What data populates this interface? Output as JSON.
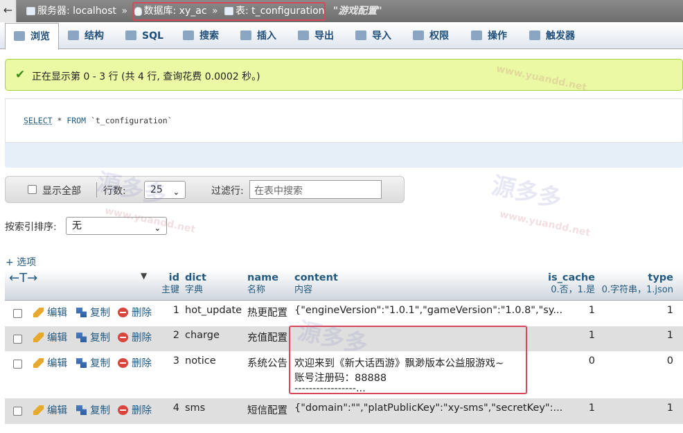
{
  "topbar": {
    "back_icon": "←",
    "server_label": "服务器: localhost",
    "db_label": "数据库: xy_ac",
    "table_label": "表: t_configuration",
    "table_comment": "\"游戏配置\"",
    "separator": "»"
  },
  "tabs": [
    {
      "label": "浏览",
      "icon": "browse-icon",
      "active": true
    },
    {
      "label": "结构",
      "icon": "structure-icon"
    },
    {
      "label": "SQL",
      "icon": "sql-icon"
    },
    {
      "label": "搜索",
      "icon": "search-icon"
    },
    {
      "label": "插入",
      "icon": "insert-icon"
    },
    {
      "label": "导出",
      "icon": "export-icon"
    },
    {
      "label": "导入",
      "icon": "import-icon"
    },
    {
      "label": "权限",
      "icon": "privileges-icon"
    },
    {
      "label": "操作",
      "icon": "operations-icon"
    },
    {
      "label": "触发器",
      "icon": "triggers-icon"
    }
  ],
  "success": {
    "check": "✔",
    "message": "正在显示第 0 - 3 行 (共 4 行, 查询花费 0.0002 秒。)"
  },
  "sql": {
    "select": "SELECT",
    "star": " * ",
    "from": "FROM",
    "table": " `t_configuration`"
  },
  "nav": {
    "show_all": "显示全部",
    "rows_label": "行数:",
    "rows_value": "25",
    "filter_label": "过滤行:",
    "filter_placeholder": "在表中搜索"
  },
  "sort": {
    "label": "按索引排序:",
    "value": "无"
  },
  "options_link": "+ 选项",
  "table": {
    "arrows": "←T→",
    "sort_marker": "▼",
    "columns": [
      {
        "name": "id",
        "comment": "主键"
      },
      {
        "name": "dict",
        "comment": "字典"
      },
      {
        "name": "name",
        "comment": "名称"
      },
      {
        "name": "content",
        "comment": "内容"
      },
      {
        "name": "is_cache",
        "comment": "0.否，1.是"
      },
      {
        "name": "type",
        "comment": "0.字符串，1.json"
      }
    ],
    "actions": {
      "edit": "编辑",
      "copy": "复制",
      "delete": "删除"
    },
    "rows": [
      {
        "id": "1",
        "dict": "hot_update",
        "name": "热更配置",
        "content": "{\"engineVersion\":\"1.0.1\",\"gameVersion\":\"1.0.8\",\"sy...",
        "content2": "",
        "content3": "",
        "is_cache": "1",
        "type": "1"
      },
      {
        "id": "2",
        "dict": "charge",
        "name": "充值配置",
        "content": "",
        "content2": "",
        "content3": "",
        "is_cache": "1",
        "type": "1"
      },
      {
        "id": "3",
        "dict": "notice",
        "name": "系统公告",
        "content": "欢迎来到《新大话西游》飘渺版本公益服游戏~",
        "content2": "账号注册码：88888",
        "content3": "-----------------...",
        "is_cache": "0",
        "type": "0"
      },
      {
        "id": "4",
        "dict": "sms",
        "name": "短信配置",
        "content": "{\"domain\":\"\",\"platPublicKey\":\"xy-sms\",\"secretKey\":...",
        "content2": "",
        "content3": "",
        "is_cache": "1",
        "type": "1"
      }
    ]
  },
  "watermark": {
    "text": "源多多",
    "url": "www.yuandd.net"
  },
  "colors": {
    "accent": "#235a81",
    "success_bg": "#ebf8a4",
    "highlight": "#d9475b"
  }
}
